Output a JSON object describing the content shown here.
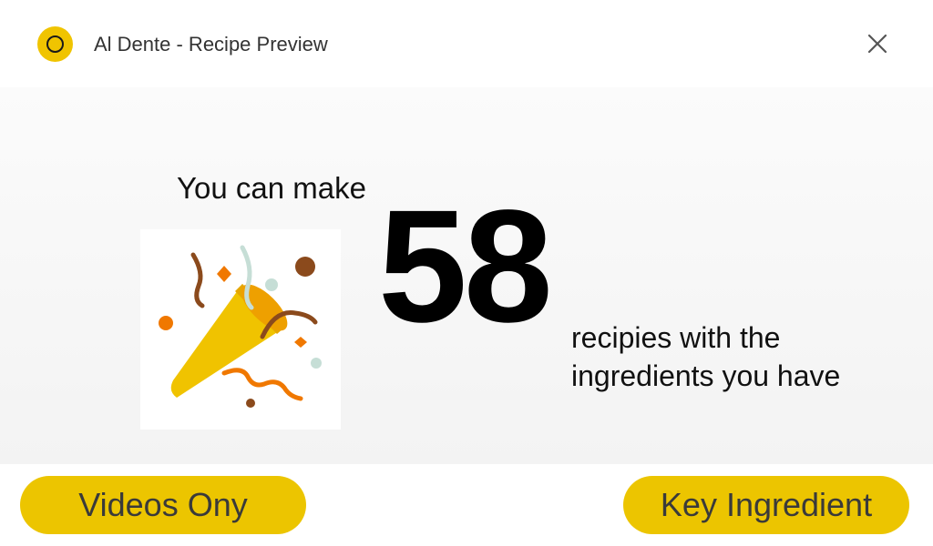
{
  "window": {
    "title": "Al Dente - Recipe Preview",
    "logo_icon": "app-logo-icon",
    "close_icon": "close-icon"
  },
  "colors": {
    "accent": "#ecc500",
    "text": "#111111",
    "confetti_orange": "#f07800",
    "confetti_brown": "#8b4a1c",
    "confetti_mint": "#c6ded6"
  },
  "hero": {
    "intro": "You can make",
    "count": "58",
    "subtext_line1": "recipies with the",
    "subtext_line2": "ingredients you have",
    "illustration_icon": "party-popper-icon"
  },
  "buttons": {
    "videos_only": "Videos Ony",
    "key_ingredient": "Key Ingredient"
  }
}
